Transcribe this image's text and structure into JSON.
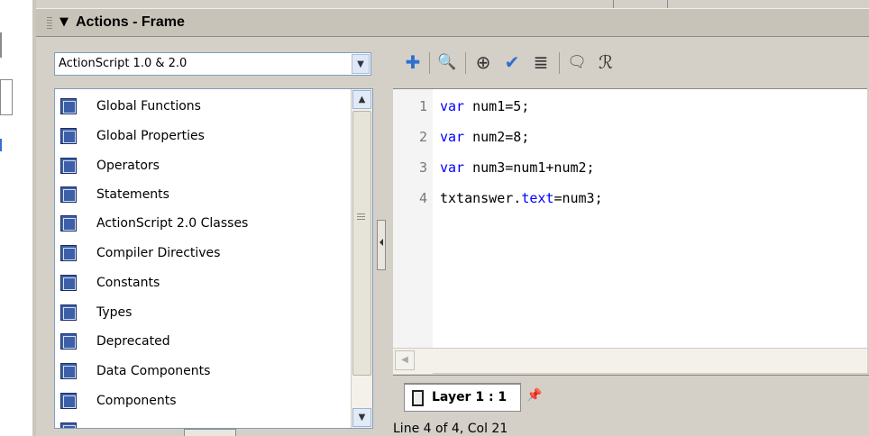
{
  "panel": {
    "title": "Actions - Frame",
    "collapse_glyph": "▼"
  },
  "language_select": {
    "value": "ActionScript 1.0 & 2.0",
    "arrow": "▼"
  },
  "toolbox": {
    "items": [
      {
        "label": "Global Functions"
      },
      {
        "label": "Global Properties"
      },
      {
        "label": "Operators"
      },
      {
        "label": "Statements"
      },
      {
        "label": "ActionScript 2.0 Classes"
      },
      {
        "label": "Compiler Directives"
      },
      {
        "label": "Constants"
      },
      {
        "label": "Types"
      },
      {
        "label": "Deprecated"
      },
      {
        "label": "Data Components"
      },
      {
        "label": "Components"
      }
    ],
    "book_glyph": "↗"
  },
  "toolbar": {
    "icons": [
      {
        "name": "add-statement-icon",
        "glyph": "✚"
      },
      {
        "name": "find-icon",
        "glyph": "🔍"
      },
      {
        "name": "insert-target-path-icon",
        "glyph": "⊕"
      },
      {
        "name": "check-syntax-icon",
        "glyph": "✔"
      },
      {
        "name": "auto-format-icon",
        "glyph": "≣"
      },
      {
        "name": "show-code-hint-icon",
        "glyph": "🗨"
      },
      {
        "name": "debug-options-icon",
        "glyph": "ℛ"
      }
    ]
  },
  "editor": {
    "lines": [
      {
        "number": "1",
        "keyword": "var",
        "rest": " num1=5;"
      },
      {
        "number": "2",
        "keyword": "var",
        "rest": " num2=8;"
      },
      {
        "number": "3",
        "keyword": "var",
        "rest": " num3=num1+num2;"
      },
      {
        "number": "4",
        "pre": "txtanswer.",
        "prop": "text",
        "post": "=num3;"
      }
    ],
    "colors": {
      "keyword": "#0000ff"
    }
  },
  "tab": {
    "label": "Layer 1 : 1"
  },
  "status": {
    "text": "Line 4 of 4, Col 21"
  }
}
